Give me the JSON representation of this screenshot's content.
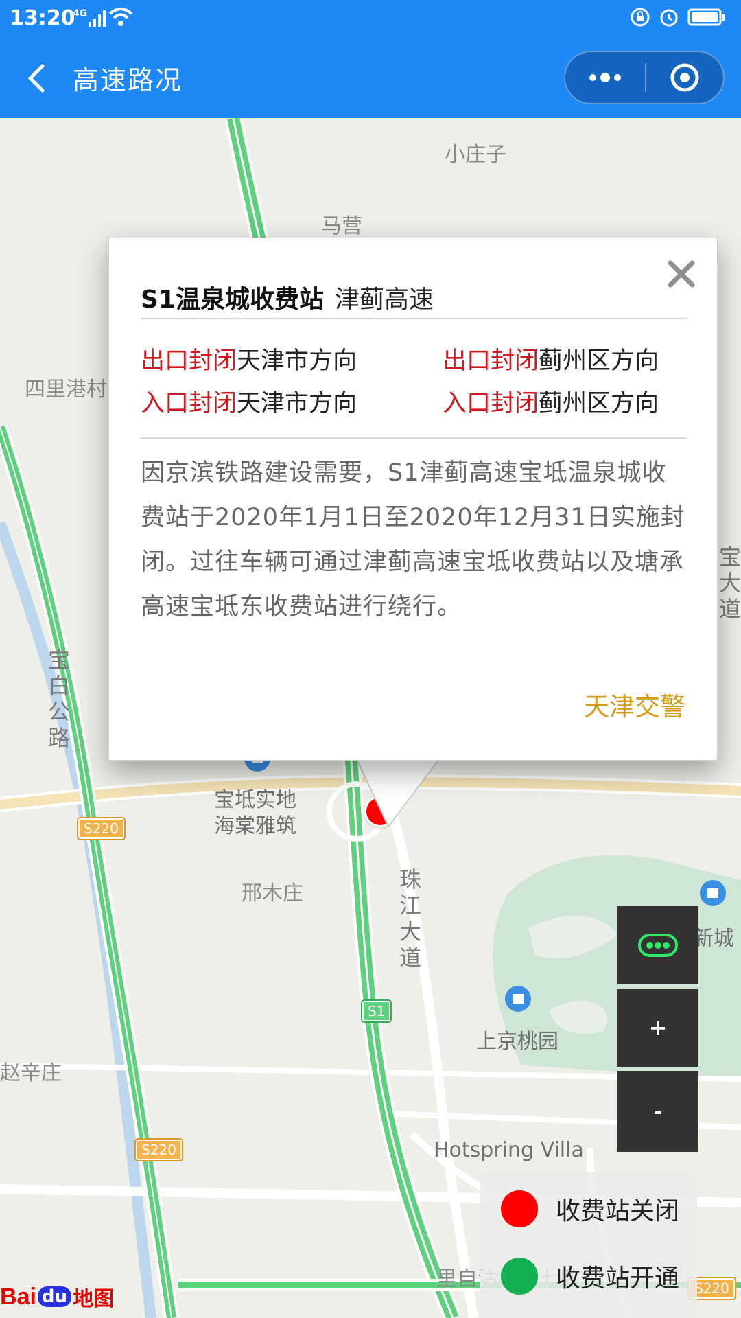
{
  "status_bar": {
    "time": "13:20",
    "network": "4G",
    "colors": {
      "bg": "#1e88f5"
    }
  },
  "header": {
    "title": "高速路况"
  },
  "map": {
    "labels": {
      "xiaozhuangzi": "小庄子",
      "maying": "马营",
      "silигang": "四里港村",
      "baodi_road": "宝白公路",
      "baodi_shidi": "宝坻实地",
      "haitang": "海棠雅筑",
      "xingmuzhuang": "邢木庄",
      "zhujiang": "珠江大道",
      "xincheng": "新城",
      "shangjing": "上京桃园",
      "hotspring": "Hotspring Villa",
      "xinzhuang": "赵辛庄",
      "lizi": "里自沽农场七队",
      "right_dao": "宝大道"
    },
    "shields": {
      "s220_a": "S220",
      "s220_b": "S220",
      "s220_c": "S220",
      "s1": "S1"
    }
  },
  "popup": {
    "station_name": "S1温泉城收费站",
    "highway_name": "津蓟高速",
    "statuses": [
      {
        "state": "出口封闭",
        "direction": "天津市方向"
      },
      {
        "state": "出口封闭",
        "direction": "蓟州区方向"
      },
      {
        "state": "入口封闭",
        "direction": "天津市方向"
      },
      {
        "state": "入口封闭",
        "direction": "蓟州区方向"
      }
    ],
    "description": "因京滨铁路建设需要，S1津蓟高速宝坻温泉城收费站于2020年1月1日至2020年12月31日实施封闭。过往车辆可通过津蓟高速宝坻收费站以及塘承高速宝坻东收费站进行绕行。",
    "source": "天津交警"
  },
  "controls": {
    "zoom_in": "+",
    "zoom_out": "-"
  },
  "legend": {
    "closed_label": "收费站关闭",
    "open_label": "收费站开通",
    "closed_color": "#ff0000",
    "open_color": "#12b050"
  },
  "logo": {
    "text_a": "Bai",
    "text_b": "du",
    "text_c": "地图"
  }
}
